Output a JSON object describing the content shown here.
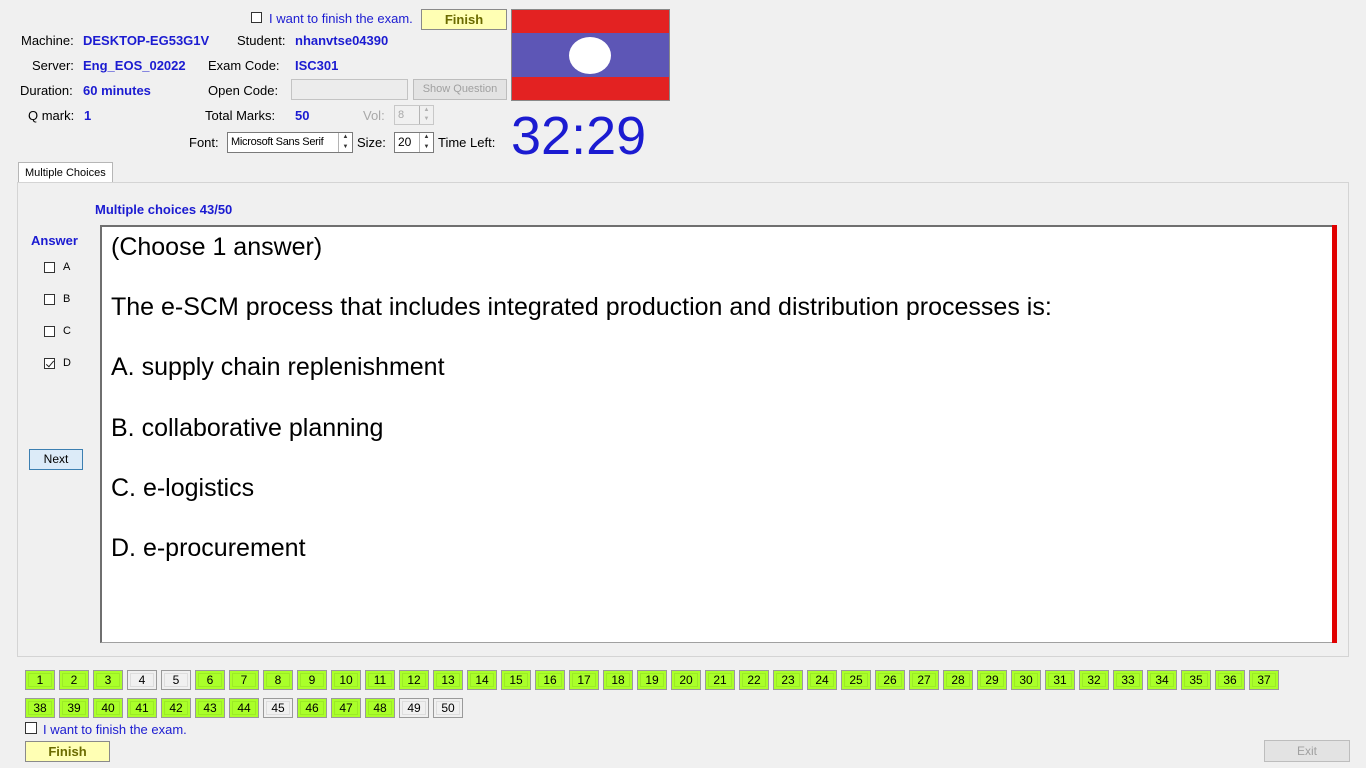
{
  "header": {
    "finish_check_label": "I want to finish the exam.",
    "finish_button_label": "Finish",
    "machine_label": "Machine:",
    "machine_value": "DESKTOP-EG53G1V",
    "student_label": "Student:",
    "student_value": "nhanvtse04390",
    "server_label": "Server:",
    "server_value": "Eng_EOS_02022",
    "exam_code_label": "Exam Code:",
    "exam_code_value": "ISC301",
    "duration_label": "Duration:",
    "duration_value": "60 minutes",
    "open_code_label": "Open Code:",
    "open_code_value": "",
    "show_question_label": "Show Question",
    "qmark_label": "Q mark:",
    "qmark_value": "1",
    "total_marks_label": "Total Marks:",
    "total_marks_value": "50",
    "vol_label": "Vol:",
    "vol_value": "8",
    "font_label": "Font:",
    "font_value": "Microsoft Sans Serif",
    "size_label": "Size:",
    "size_value": "20",
    "time_left_label": "Time Left:",
    "time_left_value": "32:29"
  },
  "colors": {
    "accent_blue": "#1b1bd1",
    "flag_red": "#e32222",
    "flag_blue": "#5d56b6",
    "answered_green": "#aaff2a",
    "finish_yellow": "#ffffb4",
    "divider_red": "#e00000"
  },
  "tab": {
    "label": "Multiple Choices"
  },
  "main": {
    "progress_label": "Multiple choices 43/50",
    "answer_header": "Answer",
    "answers": [
      {
        "label": "A",
        "checked": false
      },
      {
        "label": "B",
        "checked": false
      },
      {
        "label": "C",
        "checked": false
      },
      {
        "label": "D",
        "checked": true
      }
    ],
    "next_label": "Next",
    "question": {
      "instruction": "(Choose 1 answer)",
      "text": "The e-SCM process that includes integrated production and distribution processes is:",
      "options": [
        "A.  supply chain replenishment",
        "B.  collaborative planning",
        "C.  e-logistics",
        "D.  e-procurement"
      ]
    }
  },
  "question_nav": {
    "row1": [
      {
        "n": "1",
        "answered": true
      },
      {
        "n": "2",
        "answered": true
      },
      {
        "n": "3",
        "answered": true
      },
      {
        "n": "4",
        "answered": false
      },
      {
        "n": "5",
        "answered": false
      },
      {
        "n": "6",
        "answered": true
      },
      {
        "n": "7",
        "answered": true
      },
      {
        "n": "8",
        "answered": true
      },
      {
        "n": "9",
        "answered": true
      },
      {
        "n": "10",
        "answered": true
      },
      {
        "n": "11",
        "answered": true
      },
      {
        "n": "12",
        "answered": true
      },
      {
        "n": "13",
        "answered": true
      },
      {
        "n": "14",
        "answered": true
      },
      {
        "n": "15",
        "answered": true
      },
      {
        "n": "16",
        "answered": true
      },
      {
        "n": "17",
        "answered": true
      },
      {
        "n": "18",
        "answered": true
      },
      {
        "n": "19",
        "answered": true
      },
      {
        "n": "20",
        "answered": true
      },
      {
        "n": "21",
        "answered": true
      },
      {
        "n": "22",
        "answered": true
      },
      {
        "n": "23",
        "answered": true
      },
      {
        "n": "24",
        "answered": true
      },
      {
        "n": "25",
        "answered": true
      },
      {
        "n": "26",
        "answered": true
      },
      {
        "n": "27",
        "answered": true
      },
      {
        "n": "28",
        "answered": true
      },
      {
        "n": "29",
        "answered": true
      },
      {
        "n": "30",
        "answered": true
      },
      {
        "n": "31",
        "answered": true
      },
      {
        "n": "32",
        "answered": true
      },
      {
        "n": "33",
        "answered": true
      },
      {
        "n": "34",
        "answered": true
      },
      {
        "n": "35",
        "answered": true
      },
      {
        "n": "36",
        "answered": true
      },
      {
        "n": "37",
        "answered": true
      }
    ],
    "row2": [
      {
        "n": "38",
        "answered": true
      },
      {
        "n": "39",
        "answered": true
      },
      {
        "n": "40",
        "answered": true
      },
      {
        "n": "41",
        "answered": true
      },
      {
        "n": "42",
        "answered": true
      },
      {
        "n": "43",
        "answered": true
      },
      {
        "n": "44",
        "answered": true
      },
      {
        "n": "45",
        "answered": false
      },
      {
        "n": "46",
        "answered": true
      },
      {
        "n": "47",
        "answered": true
      },
      {
        "n": "48",
        "answered": true
      },
      {
        "n": "49",
        "answered": false
      },
      {
        "n": "50",
        "answered": false
      }
    ]
  },
  "footer": {
    "finish_check_label": "I want to finish the exam.",
    "finish_button_label": "Finish",
    "exit_label": "Exit"
  }
}
